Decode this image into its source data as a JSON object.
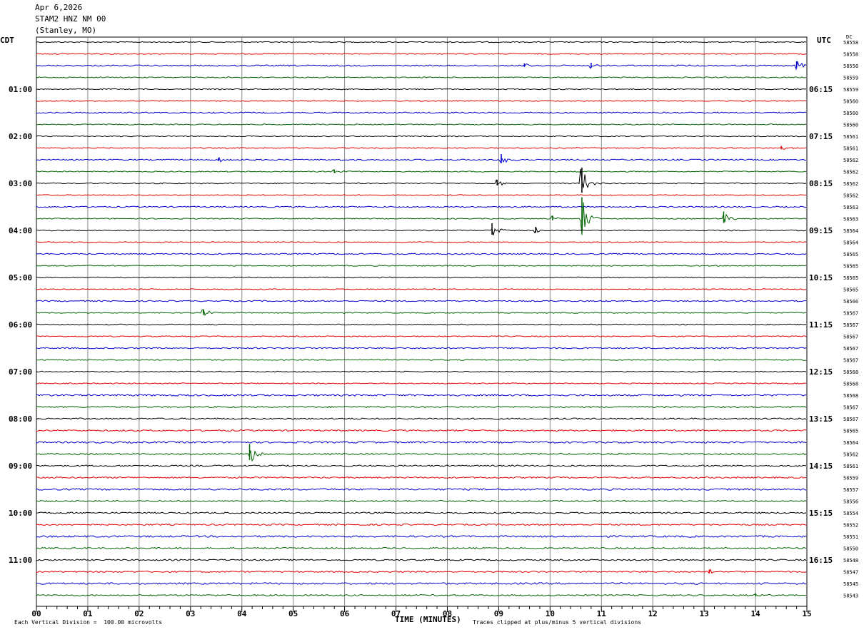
{
  "header": {
    "date": "Apr 6,2026",
    "station": "STAM2 HNZ NM 00",
    "location": "(Stanley, MO)"
  },
  "chart_data": {
    "type": "line",
    "title": "",
    "xlabel": "TIME (MINUTES)",
    "ylabel": "",
    "left_axis_label": "CDT",
    "right_axis_label": "UTC",
    "dc_label": "DC",
    "x_ticks": [
      "00",
      "01",
      "02",
      "03",
      "04",
      "05",
      "06",
      "07",
      "08",
      "09",
      "10",
      "11",
      "12",
      "13",
      "14",
      "15"
    ],
    "xlim": [
      0,
      15
    ],
    "grid": true,
    "trace_minutes": 15,
    "trace_colors": [
      "#000000",
      "#e00000",
      "#0000c8",
      "#006400"
    ],
    "left_hour_labels": [
      "01:00",
      "02:00",
      "03:00",
      "04:00",
      "05:00",
      "06:00",
      "07:00",
      "08:00",
      "09:00",
      "10:00",
      "11:00"
    ],
    "right_hour_labels": [
      "06:15",
      "07:15",
      "08:15",
      "09:15",
      "10:15",
      "11:15",
      "12:15",
      "13:15",
      "14:15",
      "15:15",
      "16:15"
    ],
    "dc_offsets": [
      "58558",
      "58558",
      "58558",
      "58559",
      "58559",
      "58560",
      "58560",
      "58560",
      "58561",
      "58561",
      "58562",
      "58562",
      "58562",
      "58562",
      "58563",
      "58563",
      "58564",
      "58564",
      "58565",
      "58565",
      "58565",
      "58565",
      "58566",
      "58567",
      "58567",
      "58567",
      "58567",
      "58567",
      "58568",
      "58568",
      "58568",
      "58567",
      "58567",
      "58565",
      "58564",
      "58562",
      "58561",
      "58559",
      "58557",
      "58556",
      "58554",
      "58552",
      "58551",
      "58550",
      "58548",
      "58547",
      "58545",
      "58543"
    ],
    "events": [
      {
        "trace": 2,
        "minute": 9.5,
        "amplitude": 3
      },
      {
        "trace": 2,
        "minute": 10.8,
        "amplitude": 4
      },
      {
        "trace": 2,
        "minute": 14.8,
        "amplitude": 6
      },
      {
        "trace": 10,
        "minute": 3.55,
        "amplitude": 3
      },
      {
        "trace": 10,
        "minute": 9.05,
        "amplitude": 8
      },
      {
        "trace": 9,
        "minute": 14.5,
        "amplitude": 3
      },
      {
        "trace": 11,
        "minute": 5.8,
        "amplitude": 3
      },
      {
        "trace": 12,
        "minute": 10.62,
        "amplitude": 22
      },
      {
        "trace": 12,
        "minute": 8.97,
        "amplitude": 5
      },
      {
        "trace": 15,
        "minute": 10.62,
        "amplitude": 30
      },
      {
        "trace": 15,
        "minute": 13.38,
        "amplitude": 10
      },
      {
        "trace": 15,
        "minute": 10.05,
        "amplitude": 4
      },
      {
        "trace": 16,
        "minute": 8.87,
        "amplitude": 10
      },
      {
        "trace": 16,
        "minute": 9.72,
        "amplitude": 5
      },
      {
        "trace": 23,
        "minute": 3.25,
        "amplitude": 5
      },
      {
        "trace": 35,
        "minute": 4.15,
        "amplitude": 14
      },
      {
        "trace": 45,
        "minute": 13.1,
        "amplitude": 3
      },
      {
        "trace": 47,
        "minute": 14.0,
        "amplitude": 3
      }
    ],
    "footer_left": "Each Vertical Division =  100.00 microvolts",
    "footer_right": "Traces clipped at plus/minus 5 vertical divisions"
  }
}
